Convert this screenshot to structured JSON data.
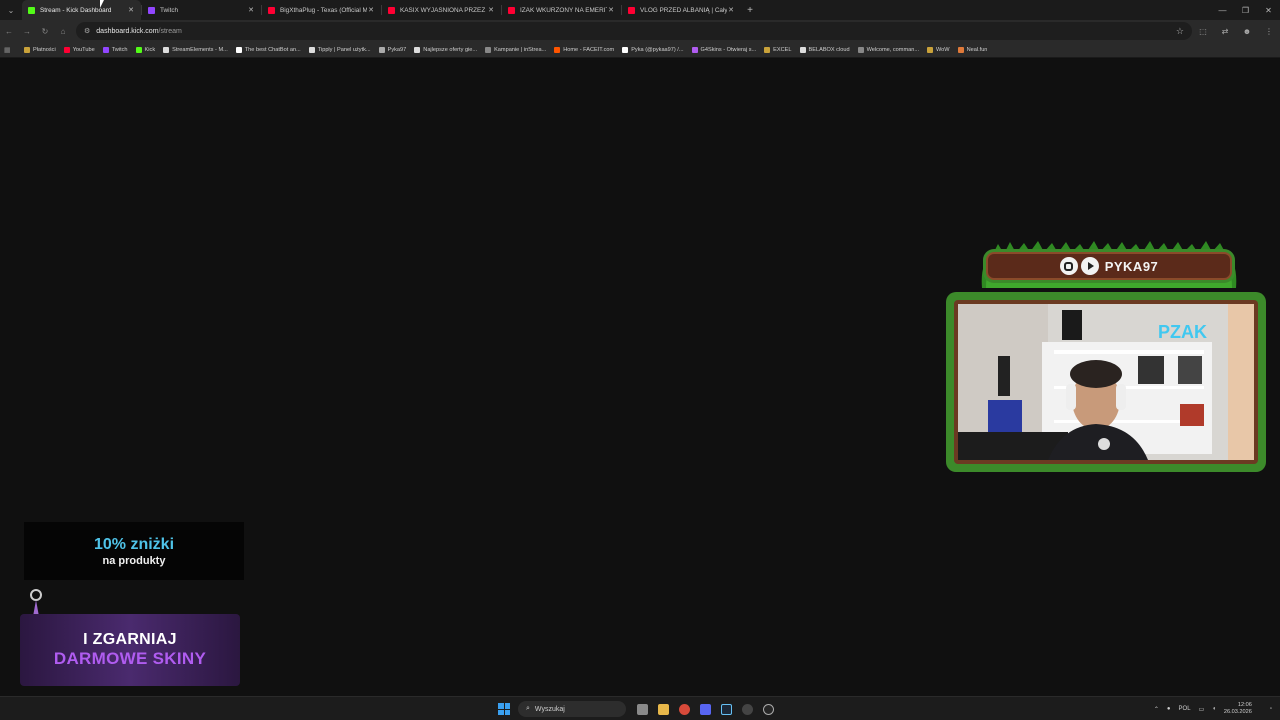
{
  "browser": {
    "tabs": [
      {
        "title": "Stream - Kick Dashboard",
        "favicon_color": "#53fc18",
        "active": true
      },
      {
        "title": "Twitch",
        "favicon_color": "#9146ff",
        "active": false
      },
      {
        "title": "BigXthaPlug - Texas (Official M",
        "favicon_color": "#ff0033",
        "active": false
      },
      {
        "title": "KASIX WYJAŚNIONA PRZEZ KA",
        "favicon_color": "#ff0033",
        "active": false
      },
      {
        "title": "IZAK WKURZONY NA EMERITO",
        "favicon_color": "#ff0033",
        "active": false
      },
      {
        "title": "VLOG PRZED ALBANIĄ | Cały vl",
        "favicon_color": "#ff0033",
        "active": false
      }
    ],
    "url_host": "dashboard.kick.com",
    "url_path": "/stream",
    "bookmarks": [
      {
        "label": "Płatności",
        "color": "#c9a23a"
      },
      {
        "label": "YouTube",
        "color": "#ff0033"
      },
      {
        "label": "Twitch",
        "color": "#9146ff"
      },
      {
        "label": "Kick",
        "color": "#53fc18"
      },
      {
        "label": "StreamElements - M...",
        "color": "#dddddd"
      },
      {
        "label": "The best ChatBot an...",
        "color": "#ffffff"
      },
      {
        "label": "Tipply | Panel użytk...",
        "color": "#dddddd"
      },
      {
        "label": "Pyka97",
        "color": "#aaaaaa"
      },
      {
        "label": "Najlepsze oferty gie...",
        "color": "#dddddd"
      },
      {
        "label": "Kampanie | inStrea...",
        "color": "#888888"
      },
      {
        "label": "Home - FACEIT.com",
        "color": "#ff5500"
      },
      {
        "label": "Pyka (@pykaa97) /...",
        "color": "#ffffff"
      },
      {
        "label": "G4Skins - Otwieraj s...",
        "color": "#b05cf0"
      },
      {
        "label": "EXCEL",
        "color": "#c9a23a"
      },
      {
        "label": "BELABOX cloud",
        "color": "#dddddd"
      },
      {
        "label": "Welcome, comman...",
        "color": "#888888"
      },
      {
        "label": "WoW",
        "color": "#c9a23a"
      },
      {
        "label": "Neal.fun",
        "color": "#e07a3a"
      }
    ]
  },
  "overlay": {
    "streamer_name": "PYKA97",
    "promo_line1": "10% zniżki",
    "promo_line2": "na produkty",
    "banner_line1": "I ZGARNIAJ",
    "banner_line2": "DARMOWE SKINY"
  },
  "taskbar": {
    "search_placeholder": "Wyszukaj",
    "language": "POL",
    "time": "12:06",
    "date": "26.03.2026"
  }
}
